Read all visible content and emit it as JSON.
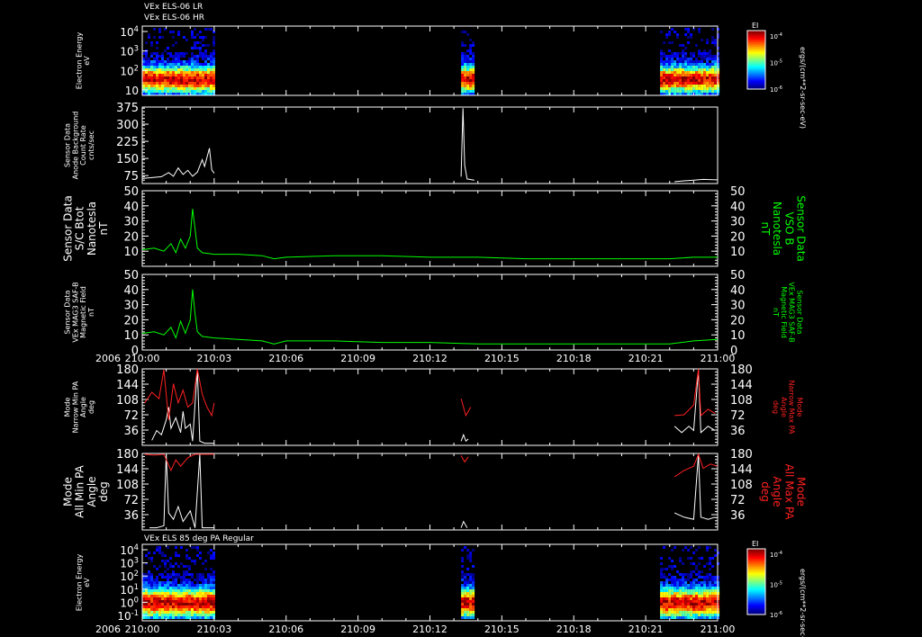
{
  "header": {
    "line1": "VEx ELS-06 LR",
    "line2": "VEx ELS-06 HR"
  },
  "colors": {
    "white": "#ffffff",
    "green": "#00ff00",
    "red": "#ff2020"
  },
  "chart_data": [
    {
      "id": "spec_top",
      "type": "heatmap",
      "ylabel": [
        "Electron Energy",
        "eV"
      ],
      "y_log": true,
      "y_ticks": [
        {
          "label": "10",
          "exp": "4"
        },
        {
          "label": "10",
          "exp": "3"
        },
        {
          "label": "10",
          "exp": "2"
        },
        {
          "label": "10",
          "exp": ""
        }
      ],
      "colorbar": {
        "title": "EI",
        "unit": "ergs/(cm**2-sr-sec-eV)",
        "ticks": [
          {
            "label": "10",
            "exp": "-4"
          },
          {
            "label": "10",
            "exp": "-5"
          },
          {
            "label": "10",
            "exp": "-6"
          }
        ]
      },
      "data_time_ranges": [
        [
          0,
          3.0
        ],
        [
          13.3,
          13.85
        ],
        [
          21.6,
          24.0
        ]
      ]
    },
    {
      "id": "count_rate",
      "type": "line",
      "ylabel": [
        "Sensor Data",
        "Anode Background",
        "Count Rate",
        "cnts/sec"
      ],
      "ylim": [
        40,
        375
      ],
      "y_ticks": [
        "375",
        "300",
        "225",
        "150",
        "75"
      ],
      "y_tick_values": [
        375,
        300,
        225,
        150,
        75
      ],
      "series": [
        {
          "color": "#ffffff",
          "segments": [
            [
              [
                0,
                62
              ],
              [
                0.4,
                66
              ],
              [
                0.8,
                70
              ],
              [
                1.1,
                88
              ],
              [
                1.3,
                72
              ],
              [
                1.5,
                108
              ],
              [
                1.7,
                80
              ],
              [
                1.9,
                98
              ],
              [
                2.1,
                72
              ],
              [
                2.3,
                90
              ],
              [
                2.5,
                145
              ],
              [
                2.6,
                115
              ],
              [
                2.8,
                195
              ],
              [
                2.9,
                100
              ],
              [
                3.0,
                85
              ]
            ],
            [
              [
                13.3,
                70
              ],
              [
                13.38,
                370
              ],
              [
                13.45,
                120
              ],
              [
                13.55,
                60
              ],
              [
                13.85,
                55
              ]
            ],
            [
              [
                22.2,
                48
              ],
              [
                22.6,
                52
              ],
              [
                23.0,
                55
              ],
              [
                23.4,
                58
              ],
              [
                23.8,
                57
              ],
              [
                24.0,
                56
              ]
            ]
          ]
        }
      ]
    },
    {
      "id": "vso_b",
      "type": "line",
      "ylabel": [
        "Sensor Data",
        "S/C Btot",
        "Nanotesla",
        "nT"
      ],
      "right_label": [
        "Sensor Data",
        "VSO B",
        "Nanotesla",
        "nT"
      ],
      "ylim": [
        0,
        50
      ],
      "y_ticks": [
        "50",
        "40",
        "30",
        "20",
        "10"
      ],
      "y_tick_values": [
        50,
        40,
        30,
        20,
        10
      ],
      "series": [
        {
          "color": "#00ff00",
          "segments": [
            [
              [
                0,
                11
              ],
              [
                0.5,
                12
              ],
              [
                0.9,
                10
              ],
              [
                1.2,
                15
              ],
              [
                1.4,
                9
              ],
              [
                1.6,
                18
              ],
              [
                1.8,
                12
              ],
              [
                2.0,
                20
              ],
              [
                2.1,
                38
              ],
              [
                2.2,
                25
              ],
              [
                2.3,
                12
              ],
              [
                2.5,
                9
              ],
              [
                3,
                8
              ],
              [
                4,
                8
              ],
              [
                5,
                7
              ],
              [
                5.5,
                5
              ],
              [
                6,
                6
              ],
              [
                8,
                7
              ],
              [
                10,
                7
              ],
              [
                12,
                6
              ],
              [
                14,
                6
              ],
              [
                16,
                5
              ],
              [
                18,
                5
              ],
              [
                20,
                5
              ],
              [
                22,
                5
              ],
              [
                23,
                6
              ],
              [
                24,
                6
              ]
            ]
          ]
        }
      ]
    },
    {
      "id": "mag3",
      "type": "line",
      "ylabel": [
        "Sensor Data",
        "VEx MAG3 SAF-B",
        "Magnetic Field",
        "nT"
      ],
      "right_label": [
        "Sensor Data",
        "VEx MAG3 SAF-B",
        "Magnetic Field",
        "nT"
      ],
      "ylim": [
        0,
        50
      ],
      "y_ticks": [
        "50",
        "40",
        "30",
        "20",
        "10",
        "0"
      ],
      "y_tick_values": [
        50,
        40,
        30,
        20,
        10,
        0
      ],
      "series": [
        {
          "color": "#00ff00",
          "segments": [
            [
              [
                0,
                11
              ],
              [
                0.5,
                12
              ],
              [
                0.9,
                10
              ],
              [
                1.2,
                15
              ],
              [
                1.4,
                8
              ],
              [
                1.6,
                19
              ],
              [
                1.8,
                11
              ],
              [
                2.0,
                20
              ],
              [
                2.1,
                40
              ],
              [
                2.2,
                24
              ],
              [
                2.3,
                12
              ],
              [
                2.5,
                9
              ],
              [
                3,
                8
              ],
              [
                4,
                7
              ],
              [
                5,
                6
              ],
              [
                5.5,
                4
              ],
              [
                6,
                6
              ],
              [
                8,
                6
              ],
              [
                10,
                5
              ],
              [
                12,
                5
              ],
              [
                14,
                4
              ],
              [
                16,
                4
              ],
              [
                18,
                4
              ],
              [
                20,
                4
              ],
              [
                22,
                4
              ],
              [
                23,
                6
              ],
              [
                24,
                7
              ]
            ]
          ]
        }
      ]
    },
    {
      "id": "narrow_pa",
      "type": "line",
      "ylabel": [
        "Mode",
        "Narrow Min PA",
        "Angle",
        "deg"
      ],
      "right_label": [
        "Mode",
        "Narrow Max PA",
        "Angle",
        "deg"
      ],
      "ylim": [
        0,
        180
      ],
      "y_ticks": [
        "180",
        "144",
        "108",
        "72",
        "36"
      ],
      "y_tick_values": [
        180,
        144,
        108,
        72,
        36
      ],
      "series": [
        {
          "color": "#ffffff",
          "segments": [
            [
              [
                0.4,
                12
              ],
              [
                0.6,
                35
              ],
              [
                0.8,
                25
              ],
              [
                1.0,
                60
              ],
              [
                1.1,
                90
              ],
              [
                1.2,
                40
              ],
              [
                1.4,
                65
              ],
              [
                1.6,
                30
              ],
              [
                1.7,
                80
              ],
              [
                1.8,
                40
              ],
              [
                2.0,
                50
              ],
              [
                2.1,
                10
              ],
              [
                2.3,
                180
              ],
              [
                2.4,
                10
              ],
              [
                2.6,
                5
              ],
              [
                3.0,
                5
              ]
            ],
            [
              [
                13.3,
                10
              ],
              [
                13.4,
                25
              ],
              [
                13.5,
                10
              ],
              [
                13.6,
                15
              ]
            ],
            [
              [
                22.2,
                45
              ],
              [
                22.5,
                30
              ],
              [
                22.8,
                45
              ],
              [
                23.0,
                35
              ],
              [
                23.2,
                178
              ],
              [
                23.3,
                30
              ],
              [
                23.6,
                45
              ],
              [
                23.9,
                35
              ]
            ]
          ]
        },
        {
          "color": "#ff2020",
          "segments": [
            [
              [
                0.1,
                100
              ],
              [
                0.4,
                125
              ],
              [
                0.7,
                110
              ],
              [
                0.9,
                178
              ],
              [
                1.1,
                60
              ],
              [
                1.3,
                145
              ],
              [
                1.5,
                100
              ],
              [
                1.7,
                130
              ],
              [
                1.9,
                90
              ],
              [
                2.1,
                100
              ],
              [
                2.3,
                180
              ],
              [
                2.5,
                120
              ],
              [
                2.7,
                90
              ],
              [
                2.9,
                70
              ],
              [
                3.0,
                100
              ]
            ],
            [
              [
                13.3,
                110
              ],
              [
                13.5,
                70
              ],
              [
                13.7,
                90
              ]
            ],
            [
              [
                22.2,
                70
              ],
              [
                22.6,
                72
              ],
              [
                23.0,
                95
              ],
              [
                23.2,
                180
              ],
              [
                23.3,
                70
              ],
              [
                23.6,
                85
              ],
              [
                23.9,
                75
              ]
            ]
          ]
        }
      ]
    },
    {
      "id": "all_pa",
      "type": "line",
      "ylabel": [
        "Mode",
        "All Min PA",
        "Angle",
        "deg"
      ],
      "right_label": [
        "Mode",
        "All Max PA",
        "Angle",
        "deg"
      ],
      "ylim": [
        0,
        180
      ],
      "y_ticks": [
        "180",
        "144",
        "108",
        "72",
        "36"
      ],
      "y_tick_values": [
        180,
        144,
        108,
        72,
        36
      ],
      "series": [
        {
          "color": "#ffffff",
          "segments": [
            [
              [
                0.3,
                5
              ],
              [
                0.6,
                5
              ],
              [
                0.9,
                10
              ],
              [
                1.0,
                178
              ],
              [
                1.1,
                40
              ],
              [
                1.3,
                25
              ],
              [
                1.5,
                55
              ],
              [
                1.7,
                20
              ],
              [
                2.0,
                45
              ],
              [
                2.2,
                5
              ],
              [
                2.4,
                178
              ],
              [
                2.5,
                5
              ],
              [
                2.8,
                5
              ],
              [
                3.0,
                5
              ]
            ],
            [
              [
                13.3,
                5
              ],
              [
                13.4,
                20
              ],
              [
                13.55,
                5
              ]
            ],
            [
              [
                22.2,
                40
              ],
              [
                22.6,
                30
              ],
              [
                23.0,
                25
              ],
              [
                23.2,
                178
              ],
              [
                23.3,
                30
              ],
              [
                23.6,
                25
              ],
              [
                23.9,
                30
              ]
            ]
          ]
        },
        {
          "color": "#ff2020",
          "segments": [
            [
              [
                0.1,
                178
              ],
              [
                0.5,
                176
              ],
              [
                0.9,
                178
              ],
              [
                1.2,
                140
              ],
              [
                1.4,
                165
              ],
              [
                1.6,
                150
              ],
              [
                1.9,
                170
              ],
              [
                2.2,
                178
              ],
              [
                2.5,
                178
              ],
              [
                3.0,
                178
              ]
            ],
            [
              [
                13.3,
                175
              ],
              [
                13.45,
                160
              ],
              [
                13.6,
                172
              ]
            ],
            [
              [
                22.2,
                125
              ],
              [
                22.6,
                140
              ],
              [
                23.0,
                150
              ],
              [
                23.2,
                178
              ],
              [
                23.4,
                145
              ],
              [
                23.7,
                155
              ],
              [
                24.0,
                150
              ]
            ]
          ]
        }
      ]
    },
    {
      "id": "spec_bottom",
      "type": "heatmap",
      "title": "VEx ELS 85 deg PA Regular",
      "ylabel": [
        "Electron Energy",
        "eV"
      ],
      "y_log": true,
      "y_ticks": [
        {
          "label": "10",
          "exp": "4"
        },
        {
          "label": "10",
          "exp": "3"
        },
        {
          "label": "10",
          "exp": "2"
        },
        {
          "label": "10",
          "exp": "1"
        },
        {
          "label": "10",
          "exp": "0"
        },
        {
          "label": "10",
          "exp": "-1"
        }
      ],
      "colorbar": {
        "title": "EI",
        "unit": "ergs/(cm**2-sr-sec-eV)",
        "ticks": [
          {
            "label": "10",
            "exp": "-4"
          },
          {
            "label": "10",
            "exp": "-5"
          },
          {
            "label": "10",
            "exp": "-6"
          }
        ]
      },
      "data_time_ranges": [
        [
          0,
          3.0
        ],
        [
          13.3,
          13.85
        ],
        [
          21.6,
          24.0
        ]
      ]
    }
  ],
  "x_axis": {
    "year_label": "2006",
    "ticks": [
      "210:00",
      "210:03",
      "210:06",
      "210:09",
      "210:12",
      "210:15",
      "210:18",
      "210:21",
      "211:00"
    ],
    "range_minutes": [
      0,
      24
    ]
  }
}
